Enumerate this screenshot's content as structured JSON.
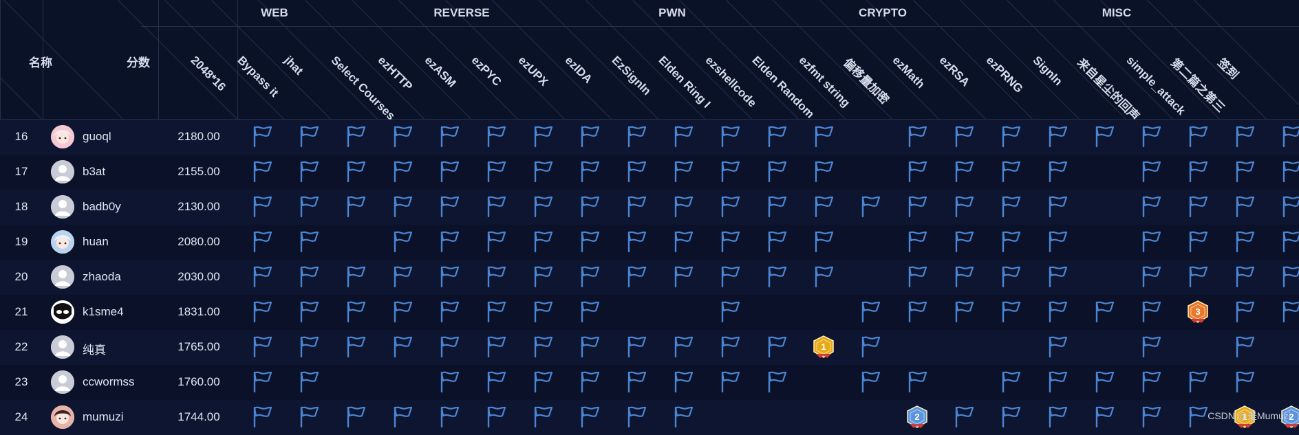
{
  "header": {
    "name_label": "名称",
    "score_label": "分数",
    "categories": [
      {
        "label": "WEB",
        "span": [
          0,
          4
        ]
      },
      {
        "label": "REVERSE",
        "span": [
          4,
          8
        ]
      },
      {
        "label": "PWN",
        "span": [
          8,
          13
        ]
      },
      {
        "label": "CRYPTO",
        "span": [
          13,
          17
        ]
      },
      {
        "label": "MISC",
        "span": [
          17,
          23
        ]
      }
    ],
    "challenges": [
      "2048*16",
      "Bypass it",
      "jhat",
      "Select Courses",
      "ezHTTP",
      "ezASM",
      "ezPYC",
      "ezUPX",
      "ezIDA",
      "EzSignIn",
      "Elden Ring I",
      "ezshellcode",
      "Elden Random ...",
      "ezfmt string",
      "偏移量加密",
      "ezMath",
      "ezRSA",
      "ezPRNG",
      "SignIn",
      "来自星尘的回声",
      "simple_attack",
      "第二篇之第三",
      "签到"
    ]
  },
  "rows": [
    {
      "rank": "16",
      "name": "guoql",
      "score": "2180.00",
      "avatar": "anime-pink-icon",
      "solves": "FFFFFFFFFFFFF.FFFFFFFFFF"
    },
    {
      "rank": "17",
      "name": "b3at",
      "score": "2155.00",
      "avatar": "default-user-icon",
      "solves": "FFFFFFFFFFFFF.FFFF.FFFFF"
    },
    {
      "rank": "18",
      "name": "badb0y",
      "score": "2130.00",
      "avatar": "default-user-icon",
      "solves": "FFFFFFFFFFFFFFFFFF.FFFFF"
    },
    {
      "rank": "19",
      "name": "huan",
      "score": "2080.00",
      "avatar": "anime-blue-icon",
      "solves": "FF.FFFFFFFFFF.FFFF.FFFFF"
    },
    {
      "rank": "20",
      "name": "zhaoda",
      "score": "2030.00",
      "avatar": "default-user-icon",
      "solves": "FFFFFFFFFFFFF.FFFF.FFFFF"
    },
    {
      "rank": "21",
      "name": "k1sme4",
      "score": "1831.00",
      "avatar": "black-white-icon",
      "solves": "FFFFFFFF..F..FFFFFFF3FF"
    },
    {
      "rank": "22",
      "name": "纯真",
      "score": "1765.00",
      "avatar": "default-user-icon",
      "solves": "FFFFFFFFFFFF1F...F.F.F"
    },
    {
      "rank": "23",
      "name": "ccwormss",
      "score": "1760.00",
      "avatar": "default-user-icon",
      "solves": "FF..FFFFFFFF.FF.FFFFFF.F"
    },
    {
      "rank": "24",
      "name": "mumuzi",
      "score": "1744.00",
      "avatar": "anime-red-icon",
      "solves": "FFFFFFFFFF....2FFFFFF12F"
    }
  ],
  "colors": {
    "background": "#0b1128",
    "row_odd": "#0e1530",
    "grid": "#26304a",
    "flag": "#4a86d4",
    "gold": "#e8a917",
    "silver_blue": "#5b93dd",
    "bronze": "#e8792a"
  },
  "watermark": "CSDN @是Mumuzi"
}
